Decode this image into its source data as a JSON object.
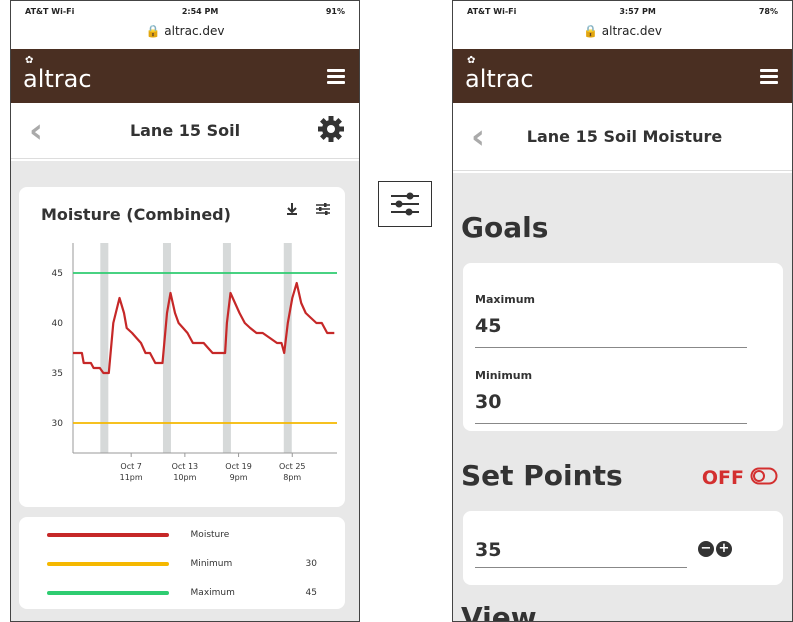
{
  "left": {
    "status": {
      "carrier": "AT&T Wi-Fi",
      "time": "2:54 PM",
      "battery": "91%"
    },
    "url": "altrac.dev",
    "app": {
      "logo": "altrac"
    },
    "nav": {
      "title": "Lane 15 Soil"
    },
    "chart_title": "Moisture (Combined)",
    "legend": [
      {
        "name": "Moisture",
        "value": "",
        "color": "#c62828"
      },
      {
        "name": "Minimum",
        "value": "30",
        "color": "#f5b800"
      },
      {
        "name": "Maximum",
        "value": "45",
        "color": "#2ecc71"
      }
    ]
  },
  "right": {
    "status": {
      "carrier": "AT&T Wi-Fi",
      "time": "3:57 PM",
      "battery": "78%"
    },
    "url": "altrac.dev",
    "app": {
      "logo": "altrac"
    },
    "nav": {
      "title": "Lane 15 Soil Moisture"
    },
    "goals": {
      "heading": "Goals",
      "max_label": "Maximum",
      "max_value": "45",
      "min_label": "Minimum",
      "min_value": "30"
    },
    "set_points": {
      "heading": "Set Points",
      "toggle_label": "OFF",
      "value": "35"
    },
    "view": {
      "heading": "View"
    }
  },
  "chart_data": {
    "type": "line",
    "title": "Moisture (Combined)",
    "xlabel": "",
    "ylabel": "",
    "ylim": [
      27,
      48
    ],
    "yticks": [
      30,
      35,
      40,
      45
    ],
    "xtick_labels": [
      [
        "Oct 7",
        "11pm"
      ],
      [
        "Oct 13",
        "10pm"
      ],
      [
        "Oct 19",
        "9pm"
      ],
      [
        "Oct 25",
        "8pm"
      ]
    ],
    "xtick_pos": [
      6.5,
      12.5,
      18.5,
      24.5
    ],
    "xlim": [
      0,
      29.5
    ],
    "night_bands": [
      3.5,
      10.5,
      17.2,
      24
    ],
    "series": [
      {
        "name": "Moisture",
        "color": "#c62828",
        "x": [
          0,
          1,
          1.2,
          2,
          2.3,
          3,
          3.4,
          4.0,
          4.5,
          5.2,
          5.7,
          6.0,
          6.6,
          7.1,
          7.6,
          8.1,
          8.6,
          9.2,
          9.8,
          10.0,
          10.5,
          10.9,
          11.4,
          11.8,
          12.3,
          12.8,
          13.4,
          14.0,
          14.6,
          15.1,
          15.6,
          16.4,
          17.0,
          17.2,
          17.6,
          18.1,
          18.6,
          19.2,
          19.8,
          20.5,
          21.2,
          22.0,
          22.8,
          23.3,
          23.6,
          24.0,
          24.5,
          25.0,
          25.5,
          26.0,
          26.6,
          27.2,
          27.8,
          28.4,
          29.2
        ],
        "y": [
          37,
          37,
          36,
          36,
          35.5,
          35.5,
          35,
          35,
          40,
          42.5,
          41,
          39.5,
          39,
          38.5,
          38,
          37,
          37,
          36,
          36,
          36,
          41,
          43,
          41,
          40,
          39.5,
          39,
          38,
          38,
          38,
          37.5,
          37,
          37,
          37,
          40,
          43,
          42,
          41,
          40,
          39.5,
          39,
          39,
          38.5,
          38,
          38,
          37,
          40,
          42.5,
          44,
          42,
          41,
          40.5,
          40,
          40,
          39,
          39
        ]
      },
      {
        "name": "Minimum",
        "color": "#f5b800",
        "x": [
          0,
          29.5
        ],
        "y": [
          30,
          30
        ]
      },
      {
        "name": "Maximum",
        "color": "#2ecc71",
        "x": [
          0,
          29.5
        ],
        "y": [
          45,
          45
        ]
      }
    ]
  }
}
